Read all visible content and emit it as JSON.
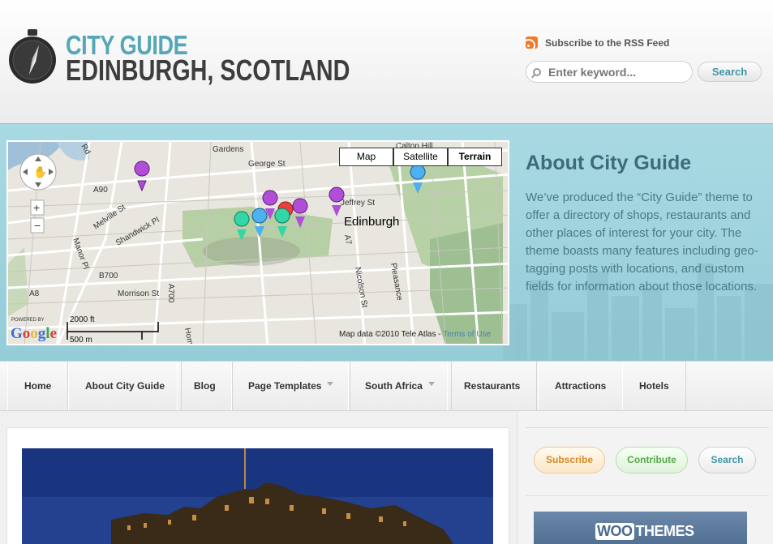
{
  "header": {
    "logo_line1": "CITY GUIDE",
    "logo_line2": "EDINBURGH, SCOTLAND",
    "rss_label": "Subscribe to the RSS Feed",
    "search_placeholder": "Enter keyword...",
    "search_button": "Search"
  },
  "map": {
    "types": [
      "Map",
      "Satellite",
      "Terrain"
    ],
    "active_type": "Terrain",
    "city_label": "Edinburgh",
    "credit": "Map data ©2010 Tele Atlas - ",
    "terms": "Terms of Use",
    "scale_ft": "2000 ft",
    "scale_m": "500 m",
    "powered_by": "POWERED BY",
    "google": "Google",
    "street_labels": [
      "Gardens",
      "George St",
      "Calton Hill",
      "Jeffrey St",
      "A90",
      "Melville St",
      "Shandwick Pl",
      "Manor Pl",
      "B700",
      "A8",
      "Morrison St",
      "A700",
      "A7",
      "Nicolson St",
      "Pleasance",
      "Hom"
    ]
  },
  "about": {
    "title": "About City Guide",
    "text": "We’ve produced the “City Guide” theme to offer a directory of shops, restaurants and other places of interest for your city. The theme boasts many features including geo-tagging posts with locations, and custom fields for information about those locations."
  },
  "nav": {
    "items": [
      {
        "label": "Home",
        "dropdown": false
      },
      {
        "label": "About City Guide",
        "dropdown": false
      },
      {
        "label": "Blog",
        "dropdown": false
      },
      {
        "label": "Page Templates",
        "dropdown": true
      },
      {
        "label": "South Africa",
        "dropdown": true
      },
      {
        "label": "Restaurants",
        "dropdown": false
      },
      {
        "label": "Attractions",
        "dropdown": false
      },
      {
        "label": "Hotels",
        "dropdown": false
      }
    ]
  },
  "sidebar": {
    "subscribe": "Subscribe",
    "contribute": "Contribute",
    "search": "Search",
    "woo_badge": "WOO",
    "woo_text": "THEMES"
  },
  "colors": {
    "accent": "#55a6b6",
    "banner": "#a9dae3",
    "rss": "#f07a2a"
  }
}
